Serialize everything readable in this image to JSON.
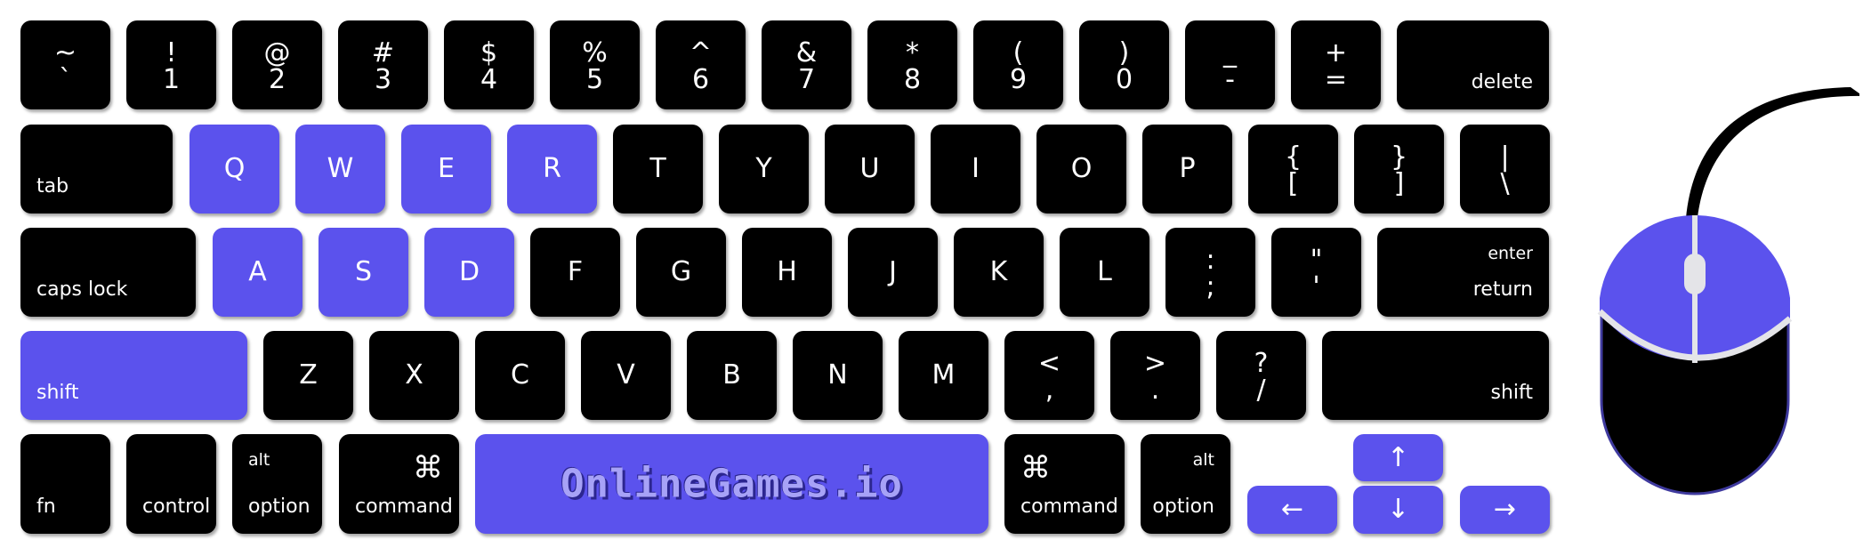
{
  "colors": {
    "highlight": "#5b52ed",
    "key": "#000000",
    "mouse_accent": "#e4e4e8"
  },
  "row1": [
    {
      "top": "~",
      "bot": "`"
    },
    {
      "top": "!",
      "bot": "1"
    },
    {
      "top": "@",
      "bot": "2"
    },
    {
      "top": "#",
      "bot": "3"
    },
    {
      "top": "$",
      "bot": "4"
    },
    {
      "top": "%",
      "bot": "5"
    },
    {
      "top": "^",
      "bot": "6"
    },
    {
      "top": "&",
      "bot": "7"
    },
    {
      "top": "*",
      "bot": "8"
    },
    {
      "top": "(",
      "bot": "9"
    },
    {
      "top": ")",
      "bot": "0"
    },
    {
      "top": "_",
      "bot": "-"
    },
    {
      "top": "+",
      "bot": "="
    }
  ],
  "delete_label": "delete",
  "tab_label": "tab",
  "row2": [
    "Q",
    "W",
    "E",
    "R",
    "T",
    "Y",
    "U",
    "I",
    "O",
    "P"
  ],
  "row2_sym": [
    {
      "top": "{",
      "bot": "["
    },
    {
      "top": "}",
      "bot": "]"
    },
    {
      "top": "|",
      "bot": "\\"
    }
  ],
  "caps_label": "caps lock",
  "row3": [
    "A",
    "S",
    "D",
    "F",
    "G",
    "H",
    "J",
    "K",
    "L"
  ],
  "row3_sym": [
    {
      "top": ":",
      "bot": ";"
    },
    {
      "top": "\"",
      "bot": "'"
    }
  ],
  "enter_label": "enter",
  "return_label": "return",
  "shift_label": "shift",
  "row4": [
    "Z",
    "X",
    "C",
    "V",
    "B",
    "N",
    "M"
  ],
  "row4_sym": [
    {
      "top": "<",
      "bot": ","
    },
    {
      "top": ">",
      "bot": "."
    },
    {
      "top": "?",
      "bot": "/"
    }
  ],
  "fn_label": "fn",
  "control_label": "control",
  "alt_label": "alt",
  "option_label": "option",
  "command_label": "command",
  "command_symbol": "⌘",
  "space_logo": "OnlineGames.io",
  "arrows": {
    "up": "↑",
    "down": "↓",
    "left": "←",
    "right": "→"
  },
  "highlighted_keys": [
    "Q",
    "W",
    "E",
    "R",
    "A",
    "S",
    "D",
    "left-shift",
    "space",
    "up",
    "down",
    "left",
    "right",
    "mouse-left-button",
    "mouse-right-button"
  ]
}
